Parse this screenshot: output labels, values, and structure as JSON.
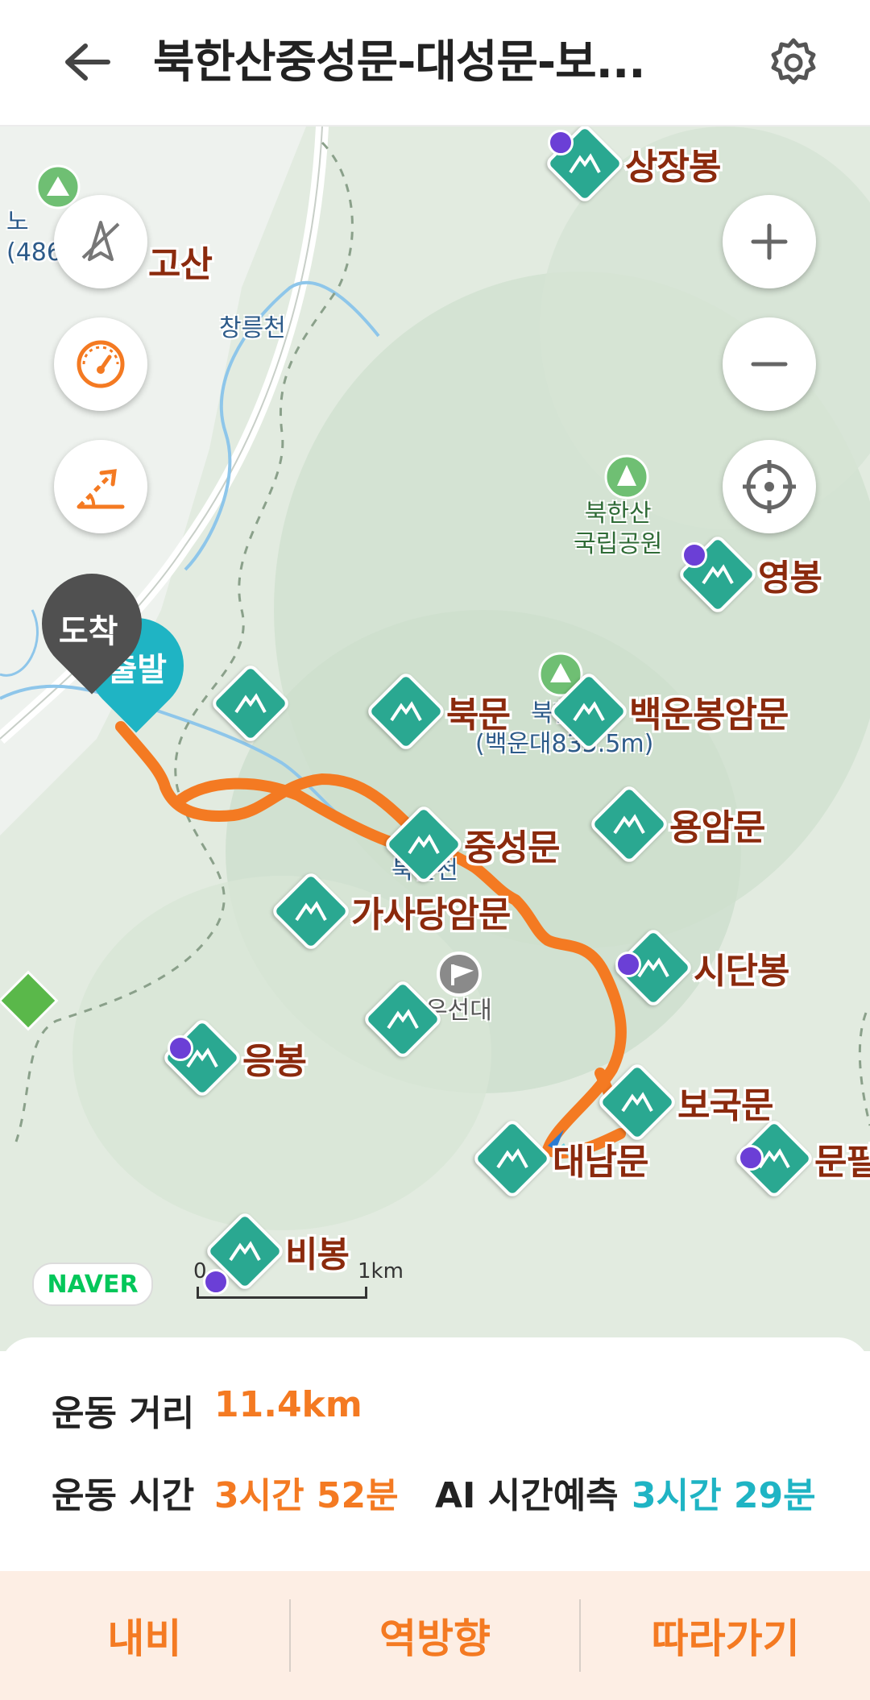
{
  "header": {
    "title": "북한산중성문-대성문-보...",
    "back_icon": "back-arrow-icon",
    "settings_icon": "gear-icon"
  },
  "map": {
    "peaks": {
      "sangjang": "상장봉",
      "gosan": "고산",
      "yeong": "영봉",
      "baegun": "백운봉암문",
      "bukmun": "북문",
      "yongam": "용암문",
      "jungseong": "중성문",
      "gasadang": "가사당암문",
      "sidan": "시단봉",
      "eung": "응봉",
      "bogukmun": "보국문",
      "daenam": "대남문",
      "munpil": "문필",
      "bibong": "비봉"
    },
    "labels": {
      "changneungcheon": "창릉천",
      "park_name_1": "북한산",
      "park_name_2": "국립공원",
      "baegundae_1": "북한산",
      "baegundae_2": "(백운대835.5m)",
      "bukhancheon": "북한천",
      "useondae": "우선대",
      "left_peak_1": "노",
      "left_peak_2": "(486."
    },
    "markers": {
      "start": "출발",
      "end": "도착"
    },
    "attribution": "NAVER",
    "scale": {
      "zero": "0",
      "unit": "1km"
    },
    "colors": {
      "route": "#f47a22",
      "poi": "#2aa891",
      "start": "#1fb4c4",
      "end": "#505050"
    }
  },
  "controls": {
    "left": [
      "compass-off-icon",
      "speedometer-icon",
      "elevation-slope-icon"
    ],
    "right": [
      "zoom-in-icon",
      "zoom-out-icon",
      "locate-me-icon"
    ]
  },
  "stats": {
    "distance_label": "운동 거리",
    "distance_value": "11.4km",
    "time_label": "운동 시간",
    "time_value": "3시간 52분",
    "ai_label": "AI 시간예측",
    "ai_value": "3시간 29분"
  },
  "actions": {
    "navi": "내비",
    "reverse": "역방향",
    "follow": "따라가기"
  }
}
